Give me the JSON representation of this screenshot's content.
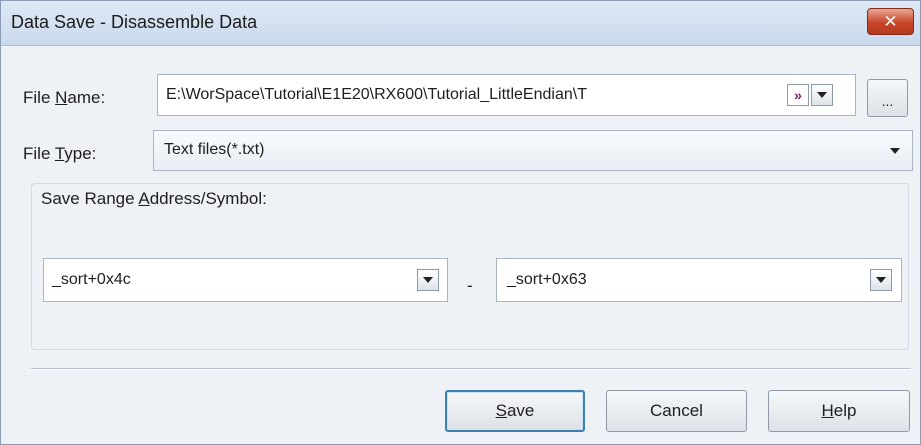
{
  "window": {
    "title": "Data Save - Disassemble Data",
    "close_glyph": "✕"
  },
  "file_name": {
    "label_pre": "File ",
    "label_accel": "N",
    "label_post": "ame:",
    "value": "E:\\WorSpace\\Tutorial\\E1E20\\RX600\\Tutorial_LittleEndian\\T",
    "macro_glyph": "»",
    "browse_label": "..."
  },
  "file_type": {
    "label_pre": "File ",
    "label_accel": "T",
    "label_post": "ype:",
    "value": "Text files(*.txt)"
  },
  "range": {
    "group_label_pre": "Save Range ",
    "group_label_accel": "A",
    "group_label_post": "ddress/Symbol:",
    "start": "_sort+0x4c",
    "separator": "-",
    "end": "_sort+0x63"
  },
  "buttons": {
    "save_accel": "S",
    "save_rest": "ave",
    "cancel": "Cancel",
    "help_accel": "H",
    "help_rest": "elp"
  },
  "icons": [
    "close-icon",
    "dropdown-arrow-icon",
    "macro-insert-icon"
  ]
}
